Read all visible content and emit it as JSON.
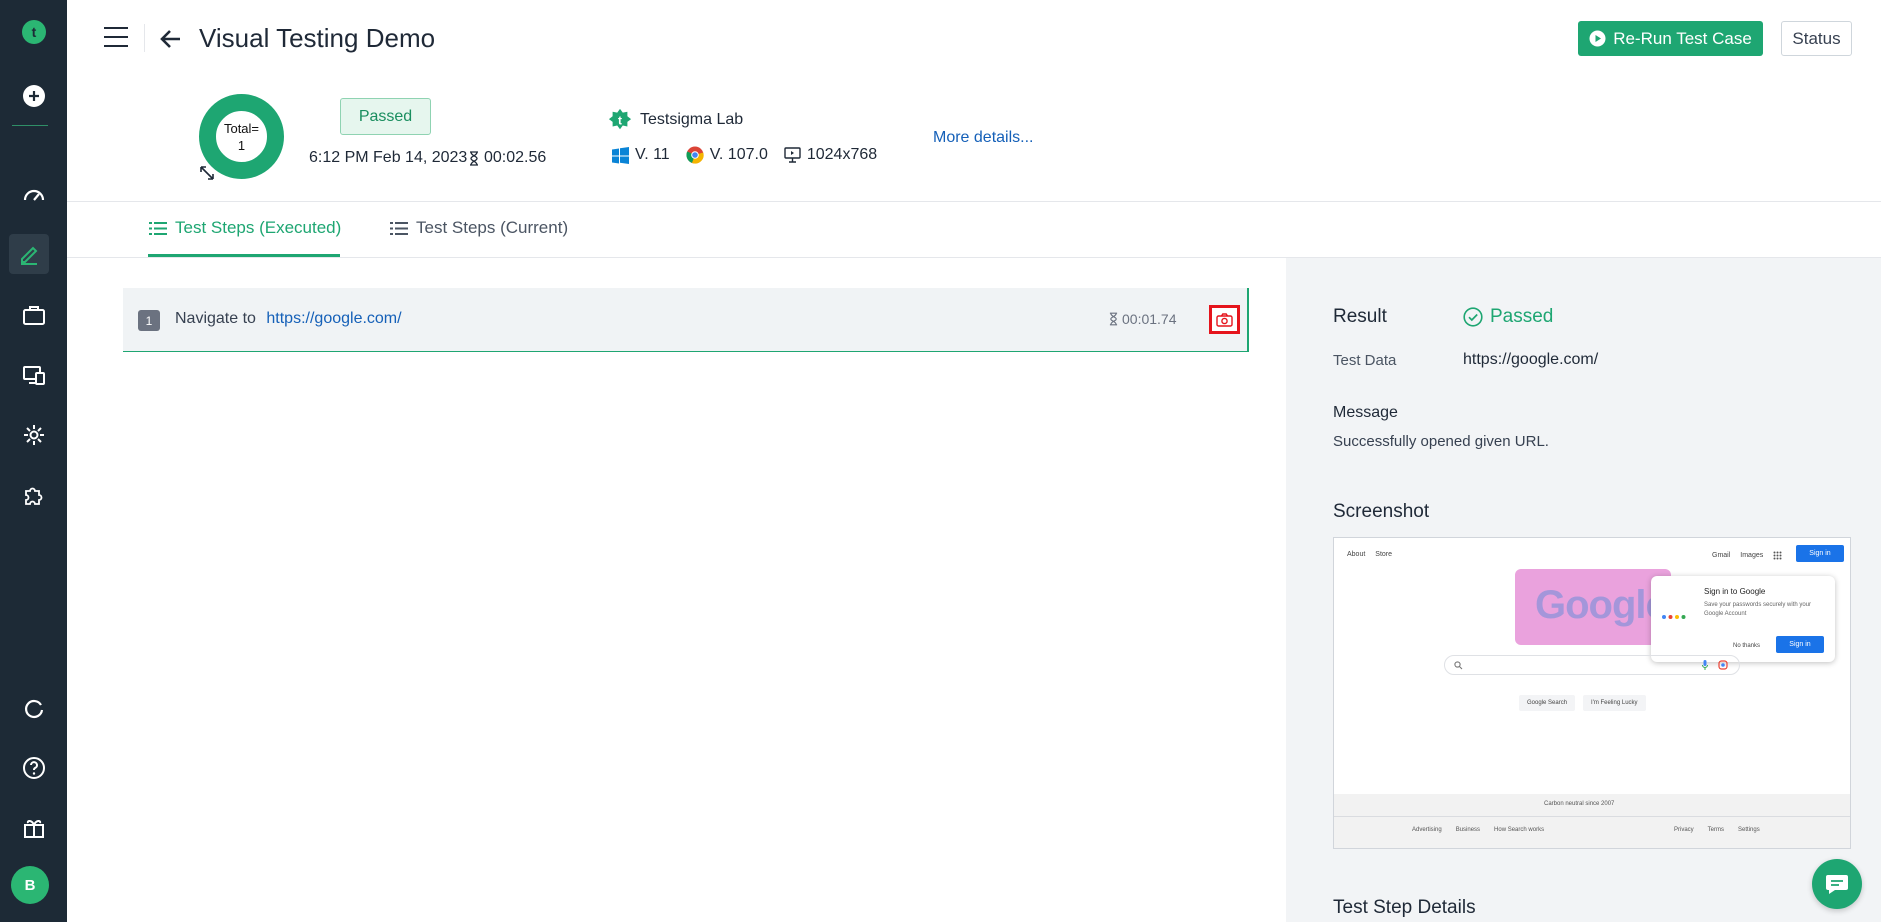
{
  "colors": {
    "brand": "#1ea672",
    "sidebar": "#1d2a36",
    "link": "#1560b8",
    "highlight": "#e5141c"
  },
  "sidebar": {
    "icons": [
      "testsigma-logo-icon",
      "add-icon",
      "dashboard-icon",
      "edit-icon",
      "briefcase-icon",
      "devices-icon",
      "settings-icon",
      "puzzle-icon",
      "refresh-icon",
      "help-icon",
      "gift-icon"
    ],
    "avatar": "B"
  },
  "header": {
    "title": "Visual Testing Demo",
    "rerun_label": "Re-Run Test Case",
    "status_label": "Status"
  },
  "summary": {
    "total_label": "Total=",
    "total_value": "1",
    "result_badge": "Passed",
    "run_date": "6:12 PM Feb 14, 2023",
    "duration": "00:02.56",
    "lab": "Testsigma Lab",
    "os_version": "V. 11",
    "browser_version": "V. 107.0",
    "resolution": "1024x768",
    "more_details": "More details..."
  },
  "tabs": [
    {
      "label": "Test Steps (Executed)",
      "active": true
    },
    {
      "label": "Test Steps (Current)",
      "active": false
    }
  ],
  "steps": [
    {
      "number": "1",
      "action": "Navigate to",
      "url": "https://google.com/",
      "duration": "00:01.74"
    }
  ],
  "details": {
    "result_label": "Result",
    "result_value": "Passed",
    "test_data_label": "Test Data",
    "test_data_value": "https://google.com/",
    "message_label": "Message",
    "message_value": "Successfully opened given URL.",
    "screenshot_label": "Screenshot",
    "step_details_label": "Test Step Details"
  },
  "thumbnail": {
    "nav_left": [
      "About",
      "Store"
    ],
    "nav_right": [
      "Gmail",
      "Images"
    ],
    "signin": "Sign in",
    "doodle_text": "Google",
    "popup_title": "Sign in to Google",
    "popup_body": "Save your passwords securely with your Google Account",
    "popup_no": "No thanks",
    "popup_signin": "Sign in",
    "search_button": "Google Search",
    "lucky_button": "I'm Feeling Lucky",
    "carbon": "Carbon neutral since 2007",
    "footer_left": [
      "Advertising",
      "Business",
      "How Search works"
    ],
    "footer_right": [
      "Privacy",
      "Terms",
      "Settings"
    ]
  }
}
